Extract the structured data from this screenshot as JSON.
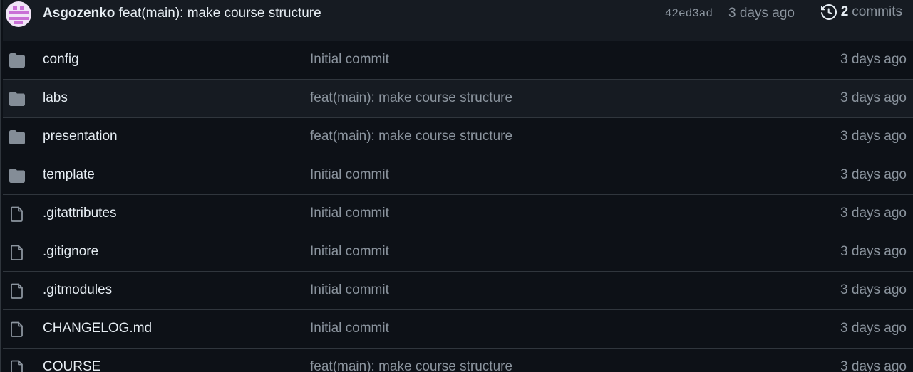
{
  "commit": {
    "author": "Asgozenko",
    "message": "feat(main): make course structure",
    "sha": "42ed3ad",
    "time": "3 days ago",
    "history_count": "2",
    "history_label": "commits"
  },
  "colors": {
    "background": "#0d1117",
    "header_background": "#161b22",
    "border": "#30363d",
    "text_primary": "#e6edf3",
    "text_muted": "#8b949e",
    "folder_icon": "#848d97"
  },
  "files": [
    {
      "type": "folder",
      "icon": "folder-icon",
      "name": "config",
      "message": "Initial commit",
      "time": "3 days ago"
    },
    {
      "type": "folder",
      "icon": "folder-icon",
      "name": "labs",
      "message": "feat(main): make course structure",
      "time": "3 days ago"
    },
    {
      "type": "folder",
      "icon": "folder-icon",
      "name": "presentation",
      "message": "feat(main): make course structure",
      "time": "3 days ago"
    },
    {
      "type": "folder",
      "icon": "folder-icon",
      "name": "template",
      "message": "Initial commit",
      "time": "3 days ago"
    },
    {
      "type": "file",
      "icon": "file-icon",
      "name": ".gitattributes",
      "message": "Initial commit",
      "time": "3 days ago"
    },
    {
      "type": "file",
      "icon": "file-icon",
      "name": ".gitignore",
      "message": "Initial commit",
      "time": "3 days ago"
    },
    {
      "type": "file",
      "icon": "file-icon",
      "name": ".gitmodules",
      "message": "Initial commit",
      "time": "3 days ago"
    },
    {
      "type": "file",
      "icon": "file-icon",
      "name": "CHANGELOG.md",
      "message": "Initial commit",
      "time": "3 days ago"
    },
    {
      "type": "file",
      "icon": "file-icon",
      "name": "COURSE",
      "message": "feat(main): make course structure",
      "time": "3 days ago"
    }
  ]
}
